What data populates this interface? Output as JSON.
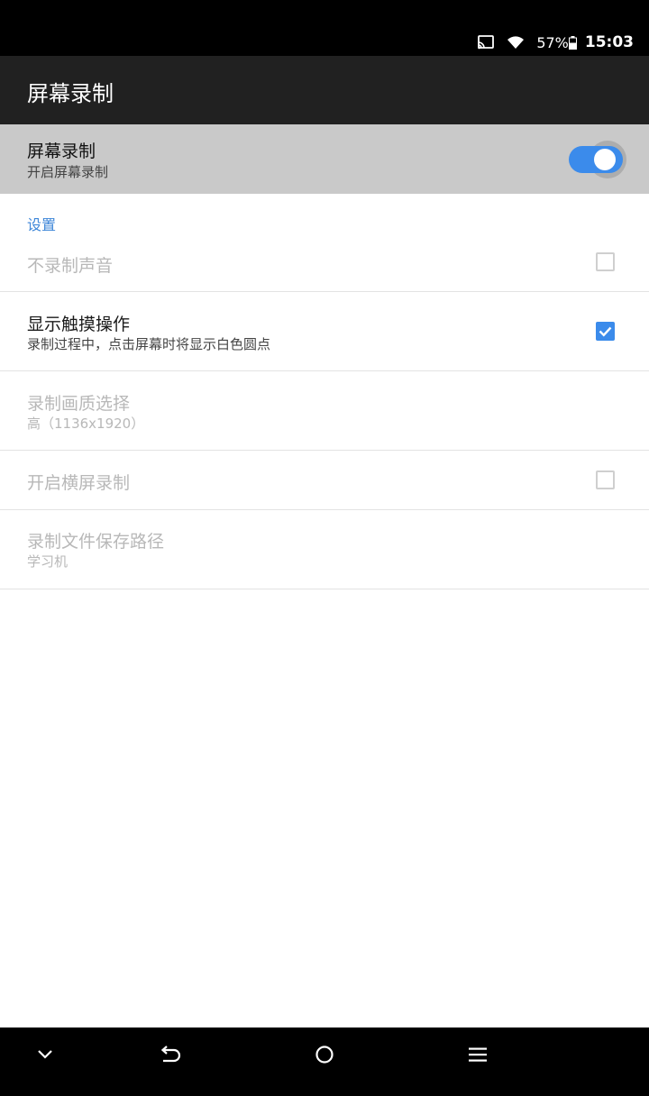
{
  "status_bar": {
    "battery_percent": "57%",
    "time": "15:03",
    "icons": [
      "cast-icon",
      "wifi-icon",
      "battery-icon"
    ]
  },
  "app_bar": {
    "title": "屏幕录制"
  },
  "master_switch": {
    "title": "屏幕录制",
    "subtitle": "开启屏幕录制",
    "enabled": true
  },
  "settings": {
    "header": "设置",
    "items": [
      {
        "title": "不录制声音",
        "type": "checkbox",
        "checked": false,
        "disabled": true
      },
      {
        "title": "显示触摸操作",
        "subtitle": "录制过程中，点击屏幕时将显示白色圆点",
        "type": "checkbox",
        "checked": true,
        "disabled": false
      },
      {
        "title": "录制画质选择",
        "subtitle": "高（1136x1920）",
        "type": "list",
        "disabled": true
      },
      {
        "title": "开启横屏录制",
        "type": "checkbox",
        "checked": false,
        "disabled": true
      },
      {
        "title": "录制文件保存路径",
        "subtitle": "学习机",
        "type": "list",
        "disabled": true
      }
    ]
  },
  "nav_bar": {
    "buttons": [
      "chevron-down-icon",
      "back-icon",
      "home-icon",
      "menu-icon"
    ]
  },
  "colors": {
    "accent": "#3b8beb",
    "app_bar": "#212121",
    "highlight_row": "#c9c9c9",
    "disabled_text": "#b8b8b8"
  }
}
